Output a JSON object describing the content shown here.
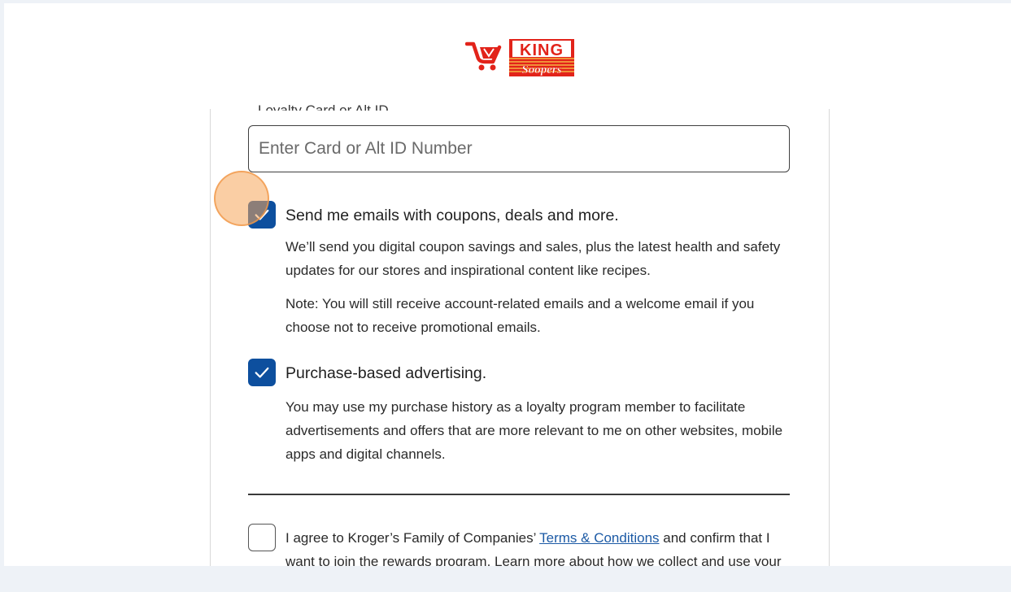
{
  "brand": {
    "logo_line1": "KING",
    "logo_line2": "Soopers"
  },
  "card_field": {
    "cut_label": "Loyalty Card or Alt ID",
    "placeholder": "Enter Card or Alt ID Number"
  },
  "email_opt": {
    "label": "Send me emails with coupons, deals and more.",
    "desc": "We’ll send you digital coupon savings and sales, plus the latest health and safety updates for our stores and inspirational content like recipes.",
    "note": "Note: You will still receive account-related emails and a welcome email if you choose not to receive promotional emails.",
    "checked": true
  },
  "ad_opt": {
    "label": "Purchase-based advertising.",
    "desc": "You may use my purchase history as a loyalty program member to facilitate advertisements and offers that are more relevant to me on other websites, mobile apps and digital channels.",
    "checked": true
  },
  "terms": {
    "prefix": "I agree to Kroger’s Family of Companies’ ",
    "link": "Terms & Conditions",
    "suffix": " and confirm that I want to join the rewards program. Learn more about how we collect and use your",
    "checked": false
  },
  "colors": {
    "accent": "#0d4f9e",
    "link": "#1c5aa5",
    "logo_red": "#e2231a",
    "tap": "#f5a65a"
  }
}
